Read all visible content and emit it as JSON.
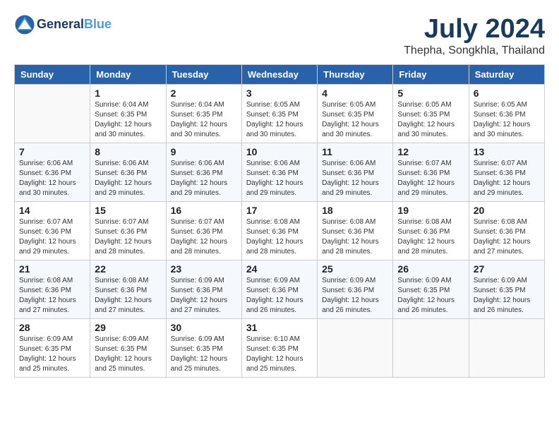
{
  "logo": {
    "line1": "General",
    "line2": "Blue"
  },
  "title": "July 2024",
  "subtitle": "Thepha, Songkhla, Thailand",
  "days_header": [
    "Sunday",
    "Monday",
    "Tuesday",
    "Wednesday",
    "Thursday",
    "Friday",
    "Saturday"
  ],
  "weeks": [
    [
      {
        "day": "",
        "info": ""
      },
      {
        "day": "1",
        "info": "Sunrise: 6:04 AM\nSunset: 6:35 PM\nDaylight: 12 hours\nand 30 minutes."
      },
      {
        "day": "2",
        "info": "Sunrise: 6:04 AM\nSunset: 6:35 PM\nDaylight: 12 hours\nand 30 minutes."
      },
      {
        "day": "3",
        "info": "Sunrise: 6:05 AM\nSunset: 6:35 PM\nDaylight: 12 hours\nand 30 minutes."
      },
      {
        "day": "4",
        "info": "Sunrise: 6:05 AM\nSunset: 6:35 PM\nDaylight: 12 hours\nand 30 minutes."
      },
      {
        "day": "5",
        "info": "Sunrise: 6:05 AM\nSunset: 6:35 PM\nDaylight: 12 hours\nand 30 minutes."
      },
      {
        "day": "6",
        "info": "Sunrise: 6:05 AM\nSunset: 6:36 PM\nDaylight: 12 hours\nand 30 minutes."
      }
    ],
    [
      {
        "day": "7",
        "info": "Sunrise: 6:06 AM\nSunset: 6:36 PM\nDaylight: 12 hours\nand 30 minutes."
      },
      {
        "day": "8",
        "info": "Sunrise: 6:06 AM\nSunset: 6:36 PM\nDaylight: 12 hours\nand 29 minutes."
      },
      {
        "day": "9",
        "info": "Sunrise: 6:06 AM\nSunset: 6:36 PM\nDaylight: 12 hours\nand 29 minutes."
      },
      {
        "day": "10",
        "info": "Sunrise: 6:06 AM\nSunset: 6:36 PM\nDaylight: 12 hours\nand 29 minutes."
      },
      {
        "day": "11",
        "info": "Sunrise: 6:06 AM\nSunset: 6:36 PM\nDaylight: 12 hours\nand 29 minutes."
      },
      {
        "day": "12",
        "info": "Sunrise: 6:07 AM\nSunset: 6:36 PM\nDaylight: 12 hours\nand 29 minutes."
      },
      {
        "day": "13",
        "info": "Sunrise: 6:07 AM\nSunset: 6:36 PM\nDaylight: 12 hours\nand 29 minutes."
      }
    ],
    [
      {
        "day": "14",
        "info": "Sunrise: 6:07 AM\nSunset: 6:36 PM\nDaylight: 12 hours\nand 29 minutes."
      },
      {
        "day": "15",
        "info": "Sunrise: 6:07 AM\nSunset: 6:36 PM\nDaylight: 12 hours\nand 28 minutes."
      },
      {
        "day": "16",
        "info": "Sunrise: 6:07 AM\nSunset: 6:36 PM\nDaylight: 12 hours\nand 28 minutes."
      },
      {
        "day": "17",
        "info": "Sunrise: 6:08 AM\nSunset: 6:36 PM\nDaylight: 12 hours\nand 28 minutes."
      },
      {
        "day": "18",
        "info": "Sunrise: 6:08 AM\nSunset: 6:36 PM\nDaylight: 12 hours\nand 28 minutes."
      },
      {
        "day": "19",
        "info": "Sunrise: 6:08 AM\nSunset: 6:36 PM\nDaylight: 12 hours\nand 28 minutes."
      },
      {
        "day": "20",
        "info": "Sunrise: 6:08 AM\nSunset: 6:36 PM\nDaylight: 12 hours\nand 27 minutes."
      }
    ],
    [
      {
        "day": "21",
        "info": "Sunrise: 6:08 AM\nSunset: 6:36 PM\nDaylight: 12 hours\nand 27 minutes."
      },
      {
        "day": "22",
        "info": "Sunrise: 6:08 AM\nSunset: 6:36 PM\nDaylight: 12 hours\nand 27 minutes."
      },
      {
        "day": "23",
        "info": "Sunrise: 6:09 AM\nSunset: 6:36 PM\nDaylight: 12 hours\nand 27 minutes."
      },
      {
        "day": "24",
        "info": "Sunrise: 6:09 AM\nSunset: 6:36 PM\nDaylight: 12 hours\nand 26 minutes."
      },
      {
        "day": "25",
        "info": "Sunrise: 6:09 AM\nSunset: 6:36 PM\nDaylight: 12 hours\nand 26 minutes."
      },
      {
        "day": "26",
        "info": "Sunrise: 6:09 AM\nSunset: 6:35 PM\nDaylight: 12 hours\nand 26 minutes."
      },
      {
        "day": "27",
        "info": "Sunrise: 6:09 AM\nSunset: 6:35 PM\nDaylight: 12 hours\nand 26 minutes."
      }
    ],
    [
      {
        "day": "28",
        "info": "Sunrise: 6:09 AM\nSunset: 6:35 PM\nDaylight: 12 hours\nand 25 minutes."
      },
      {
        "day": "29",
        "info": "Sunrise: 6:09 AM\nSunset: 6:35 PM\nDaylight: 12 hours\nand 25 minutes."
      },
      {
        "day": "30",
        "info": "Sunrise: 6:09 AM\nSunset: 6:35 PM\nDaylight: 12 hours\nand 25 minutes."
      },
      {
        "day": "31",
        "info": "Sunrise: 6:10 AM\nSunset: 6:35 PM\nDaylight: 12 hours\nand 25 minutes."
      },
      {
        "day": "",
        "info": ""
      },
      {
        "day": "",
        "info": ""
      },
      {
        "day": "",
        "info": ""
      }
    ]
  ]
}
